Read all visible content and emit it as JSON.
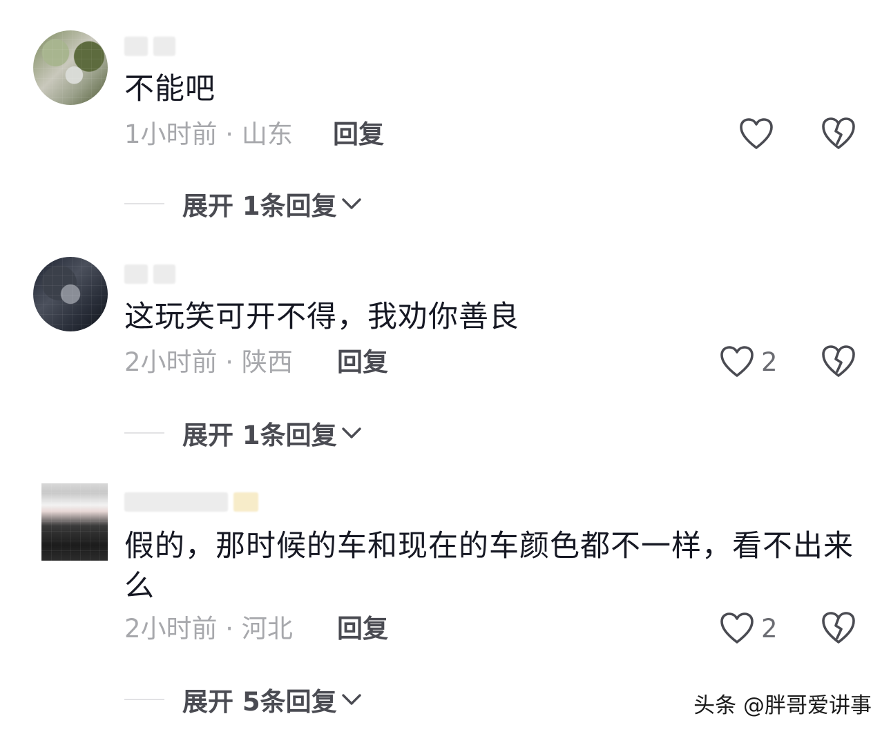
{
  "comments": [
    {
      "text": "不能吧",
      "meta": "1小时前 · 山东",
      "reply_label": "回复",
      "like_count": "",
      "expand_label": "展开 1条回复"
    },
    {
      "text": "这玩笑可开不得，我劝你善良",
      "meta": "2小时前 · 陕西",
      "reply_label": "回复",
      "like_count": "2",
      "expand_label": "展开 1条回复"
    },
    {
      "text": "假的，那时候的车和现在的车颜色都不一样，看不出来么",
      "meta": "2小时前 · 河北",
      "reply_label": "回复",
      "like_count": "2",
      "expand_label": "展开 5条回复"
    }
  ],
  "watermark": "头条 @胖哥爱讲事",
  "icons": {
    "like": "heart-outline-icon",
    "dislike": "broken-heart-icon",
    "expand": "chevron-down-icon"
  },
  "colors": {
    "text": "#161823",
    "meta": "#a7a8ac",
    "action": "#4a4b52"
  }
}
